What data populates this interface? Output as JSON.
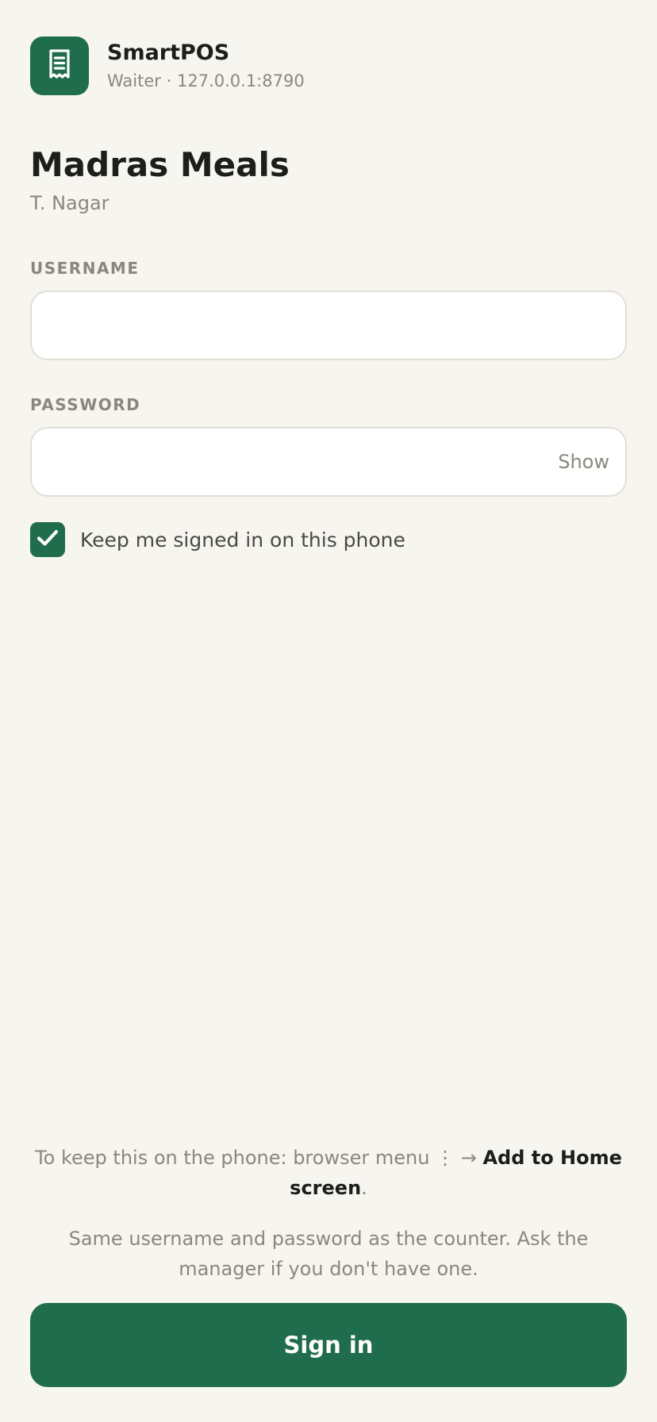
{
  "app": {
    "name": "SmartPOS",
    "role": "Waiter",
    "separator": "·",
    "host": "127.0.0.1:8790",
    "icon": "receipt-icon",
    "brand_color": "#206d4d"
  },
  "restaurant": {
    "name": "Madras Meals",
    "branch": "T. Nagar"
  },
  "form": {
    "username_label": "USERNAME",
    "username_value": "",
    "password_label": "PASSWORD",
    "password_value": "",
    "show_label": "Show",
    "keep_signed_in_label": "Keep me signed in on this phone",
    "keep_signed_in_checked": true
  },
  "footer": {
    "hint_prefix": "To keep this on the phone: browser menu",
    "hint_menu_glyph": "⋮",
    "hint_arrow": "→",
    "hint_action": "Add to Home screen",
    "hint_suffix": ".",
    "note": "Same username and password as the counter. Ask the manager if you don't have one.",
    "signin_label": "Sign in"
  }
}
